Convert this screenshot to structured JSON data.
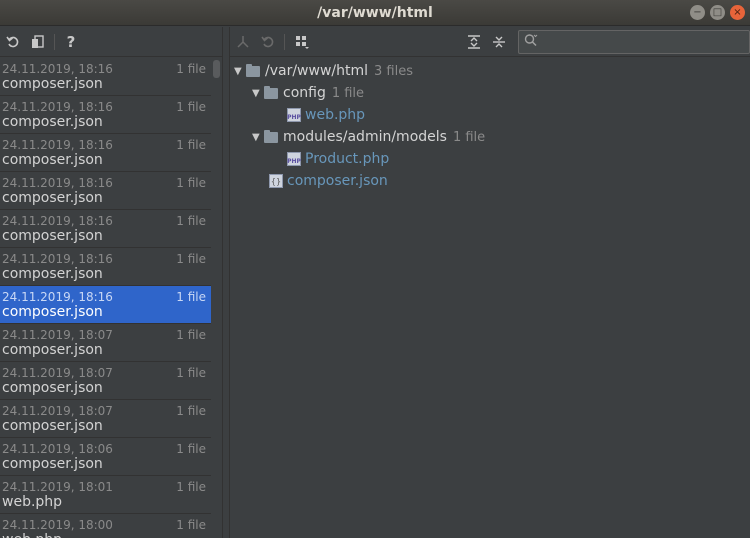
{
  "window": {
    "title": "/var/www/html",
    "min_glyph": "−",
    "max_glyph": "□",
    "close_glyph": "×"
  },
  "toolbar_left": {
    "help_glyph": "?"
  },
  "search": {
    "placeholder": "",
    "value": ""
  },
  "history": [
    {
      "date": "24.11.2019, 18:16",
      "count": "1 file",
      "name": "composer.json",
      "selected": false
    },
    {
      "date": "24.11.2019, 18:16",
      "count": "1 file",
      "name": "composer.json",
      "selected": false
    },
    {
      "date": "24.11.2019, 18:16",
      "count": "1 file",
      "name": "composer.json",
      "selected": false
    },
    {
      "date": "24.11.2019, 18:16",
      "count": "1 file",
      "name": "composer.json",
      "selected": false
    },
    {
      "date": "24.11.2019, 18:16",
      "count": "1 file",
      "name": "composer.json",
      "selected": false
    },
    {
      "date": "24.11.2019, 18:16",
      "count": "1 file",
      "name": "composer.json",
      "selected": false
    },
    {
      "date": "24.11.2019, 18:16",
      "count": "1 file",
      "name": "composer.json",
      "selected": true
    },
    {
      "date": "24.11.2019, 18:07",
      "count": "1 file",
      "name": "composer.json",
      "selected": false
    },
    {
      "date": "24.11.2019, 18:07",
      "count": "1 file",
      "name": "composer.json",
      "selected": false
    },
    {
      "date": "24.11.2019, 18:07",
      "count": "1 file",
      "name": "composer.json",
      "selected": false
    },
    {
      "date": "24.11.2019, 18:06",
      "count": "1 file",
      "name": "composer.json",
      "selected": false
    },
    {
      "date": "24.11.2019, 18:01",
      "count": "1 file",
      "name": "web.php",
      "selected": false
    },
    {
      "date": "24.11.2019, 18:00",
      "count": "1 file",
      "name": "web.php",
      "selected": false
    }
  ],
  "tree": {
    "root": {
      "label": "/var/www/html",
      "meta": "3 files"
    },
    "config": {
      "label": "config",
      "meta": "1 file"
    },
    "web_php": {
      "label": "web.php",
      "icon_text": "PHP"
    },
    "models": {
      "label": "modules/admin/models",
      "meta": "1 file"
    },
    "product_php": {
      "label": "Product.php",
      "icon_text": "PHP"
    },
    "composer_json": {
      "label": "composer.json",
      "icon_text": "{}"
    }
  },
  "colors": {
    "background": "#3c3f41",
    "selection": "#2f65ca",
    "file_link": "#6897bb",
    "close_button": "#e8643a"
  }
}
